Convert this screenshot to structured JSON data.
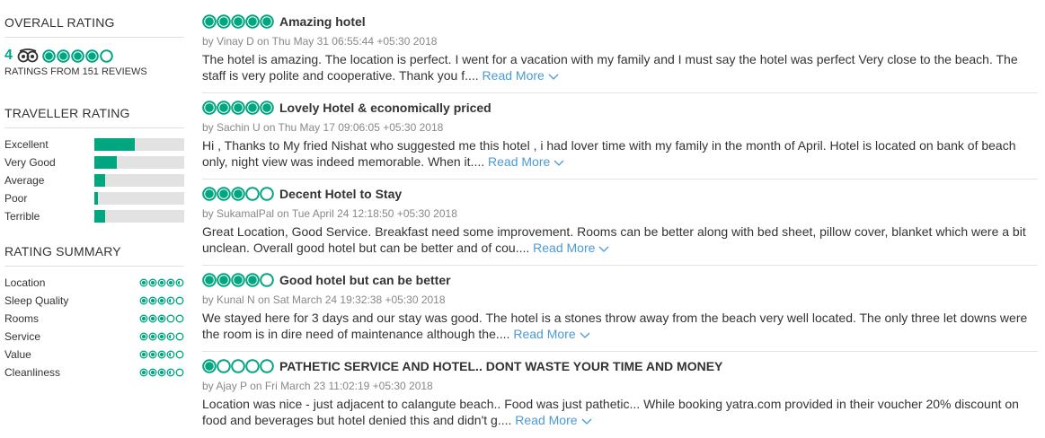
{
  "sidebar": {
    "overall": {
      "title": "OVERALL RATING",
      "score": "4",
      "bubbles": 4,
      "ratings_from": "RATINGS FROM 151 REVIEWS"
    },
    "traveller": {
      "title": "TRAVELLER RATING",
      "items": [
        {
          "label": "Excellent",
          "fill": 0.45
        },
        {
          "label": "Very Good",
          "fill": 0.25
        },
        {
          "label": "Average",
          "fill": 0.12
        },
        {
          "label": "Poor",
          "fill": 0.04
        },
        {
          "label": "Terrible",
          "fill": 0.12
        }
      ]
    },
    "summary": {
      "title": "RATING SUMMARY",
      "items": [
        {
          "label": "Location",
          "rating": 4.5
        },
        {
          "label": "Sleep Quality",
          "rating": 3.5
        },
        {
          "label": "Rooms",
          "rating": 3
        },
        {
          "label": "Service",
          "rating": 3.5
        },
        {
          "label": "Value",
          "rating": 3.5
        },
        {
          "label": "Cleanliness",
          "rating": 3.5
        }
      ]
    }
  },
  "reviews": [
    {
      "rating": 5,
      "title": "Amazing hotel",
      "meta": "by Vinay D on Thu May 31 06:55:44 +05:30 2018",
      "body": "The hotel is amazing. The location is perfect. I went for a vacation with my family and I must say the hotel was perfect Very close to the beach. The staff is very polite and cooperative. Thank you f....",
      "read_more": "Read More"
    },
    {
      "rating": 5,
      "title": "Lovely Hotel & economically priced",
      "meta": "by Sachin U on Thu May 17 09:06:05 +05:30 2018",
      "body": "Hi , Thanks to My fried Nishat who suggested me this hotel , i had lover time with my family in the month of April. Hotel is located on bank of beach only, night view was indeed memorable. When it....",
      "read_more": "Read More"
    },
    {
      "rating": 3,
      "title": "Decent Hotel to Stay",
      "meta": "by SukamalPal on Tue April 24 12:18:50 +05:30 2018",
      "body": "Great Location, Good Service. Breakfast need some improvement. Rooms can be better along with bed sheet, pillow cover, blanket which were a bit unclean. Overall good hotel but can be better and of cou....",
      "read_more": "Read More"
    },
    {
      "rating": 4,
      "title": "Good hotel but can be better",
      "meta": "by Kunal N on Sat March 24 19:32:38 +05:30 2018",
      "body": "We stayed here for 3 days and our stay was good. The hotel is a stones throw away from the beach very well located. The only three let downs were the room is in dire need of maintenance although the....",
      "read_more": "Read More"
    },
    {
      "rating": 1,
      "title": "PATHETIC SERVICE AND HOTEL.. DONT WASTE YOUR TIME AND MONEY",
      "meta": "by Ajay P on Fri March 23 11:02:19 +05:30 2018",
      "body": "Location was nice - just adjacent to calangute beach.. Food was just pathetic... While booking yatra.com provided in their voucher 20% discount on food and beverages but hotel denied this and didn't g....",
      "read_more": "Read More"
    }
  ],
  "colors": {
    "accent": "#00a680",
    "link": "#4a9ad6",
    "bar_bg": "#e2e2e2"
  }
}
